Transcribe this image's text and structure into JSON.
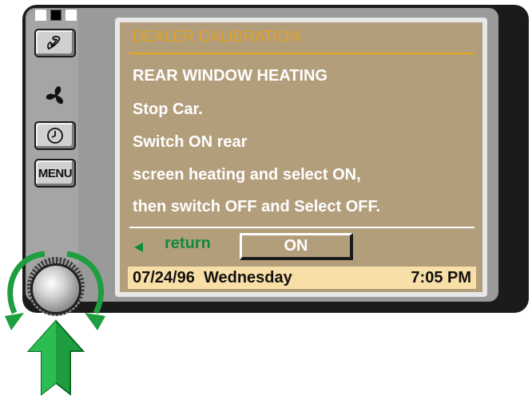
{
  "screen": {
    "title": "DEALER CALIBRATION",
    "lines": [
      "REAR WINDOW HEATING",
      "Stop Car.",
      "Switch ON rear",
      "screen heating and select ON,",
      "then switch OFF and Select OFF."
    ],
    "return_label": "return",
    "on_button_label": "ON"
  },
  "status_bar": {
    "date_day": "07/24/96  Wednesday",
    "time": "7:05 PM"
  },
  "side_panel": {
    "menu_label": "MENU",
    "icons": [
      "phone-icon",
      "fan-icon",
      "clock-icon"
    ]
  },
  "colors": {
    "screen_bg": "#b39e7c",
    "title": "#e0a222",
    "status_bar": "#f8dfa8",
    "return_green": "#108a3c",
    "arrow_green": "#1e9e3e"
  }
}
